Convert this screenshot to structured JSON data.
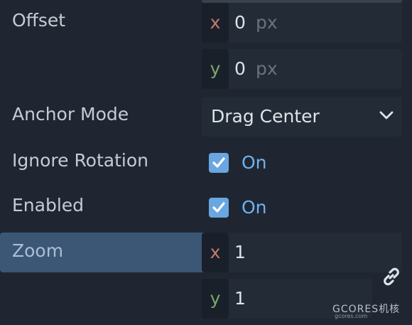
{
  "offset": {
    "label": "Offset",
    "x": {
      "axis": "x",
      "value": "0",
      "unit": "px"
    },
    "y": {
      "axis": "y",
      "value": "0",
      "unit": "px"
    }
  },
  "anchor_mode": {
    "label": "Anchor Mode",
    "selected": "Drag Center",
    "icon": "chevron-down-icon"
  },
  "ignore_rotation": {
    "label": "Ignore Rotation",
    "checked": true,
    "state_label": "On"
  },
  "enabled": {
    "label": "Enabled",
    "checked": true,
    "state_label": "On"
  },
  "zoom": {
    "label": "Zoom",
    "x": {
      "axis": "x",
      "value": "1"
    },
    "y": {
      "axis": "y",
      "value": "1"
    },
    "link_icon": "link-icon"
  },
  "watermark": {
    "text": "GCORES机核",
    "subtext": "gcores.com"
  },
  "colors": {
    "axis_x": "#c27a6f",
    "axis_y": "#79a86a",
    "accent": "#6fb2f0",
    "checkbox": "#6aa7e0",
    "highlight": "#3c5775"
  }
}
